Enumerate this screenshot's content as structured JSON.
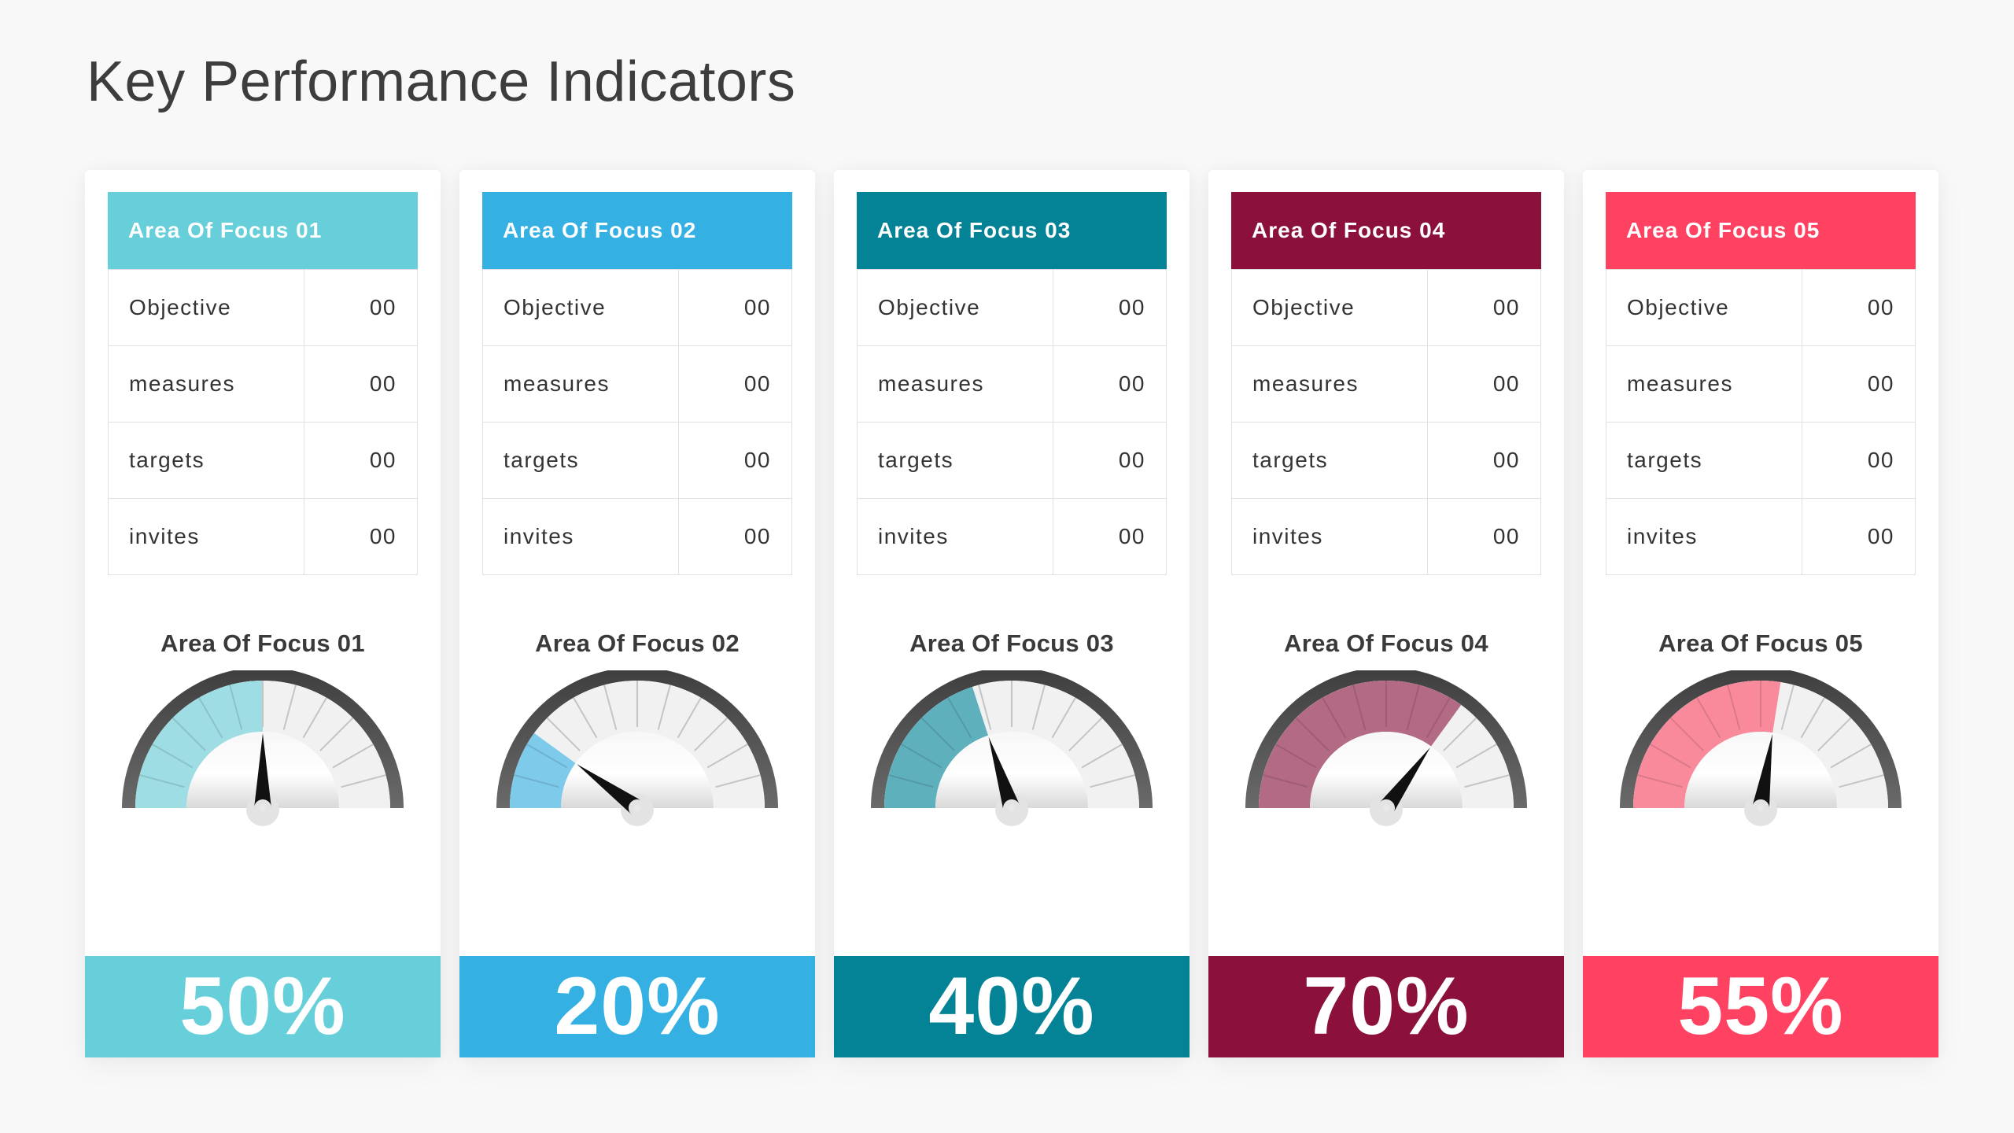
{
  "page": {
    "title": "Key Performance Indicators"
  },
  "cards": [
    {
      "header": "Area Of Focus 01",
      "color": "#66CFD9",
      "gauge_fill_color": "#9EDDE4",
      "rows": [
        {
          "label": "Objective",
          "value": "00"
        },
        {
          "label": "measures",
          "value": "00"
        },
        {
          "label": "targets",
          "value": "00"
        },
        {
          "label": "invites",
          "value": "00"
        }
      ],
      "gauge_title": "Area Of Focus 01",
      "percent": 50,
      "percent_label": "50%"
    },
    {
      "header": "Area Of Focus 02",
      "color": "#35B0E3",
      "gauge_fill_color": "#7ECAEA",
      "rows": [
        {
          "label": "Objective",
          "value": "00"
        },
        {
          "label": "measures",
          "value": "00"
        },
        {
          "label": "targets",
          "value": "00"
        },
        {
          "label": "invites",
          "value": "00"
        }
      ],
      "gauge_title": "Area Of Focus 02",
      "percent": 20,
      "percent_label": "20%"
    },
    {
      "header": "Area Of Focus 03",
      "color": "#058396",
      "gauge_fill_color": "#5FB0BD",
      "rows": [
        {
          "label": "Objective",
          "value": "00"
        },
        {
          "label": "measures",
          "value": "00"
        },
        {
          "label": "targets",
          "value": "00"
        },
        {
          "label": "invites",
          "value": "00"
        }
      ],
      "gauge_title": "Area Of Focus 03",
      "percent": 40,
      "percent_label": "40%"
    },
    {
      "header": "Area Of Focus 04",
      "color": "#8B113C",
      "gauge_fill_color": "#B36A85",
      "rows": [
        {
          "label": "Objective",
          "value": "00"
        },
        {
          "label": "measures",
          "value": "00"
        },
        {
          "label": "targets",
          "value": "00"
        },
        {
          "label": "invites",
          "value": "00"
        }
      ],
      "gauge_title": "Area Of Focus 04",
      "percent": 70,
      "percent_label": "70%"
    },
    {
      "header": "Area Of Focus 05",
      "color": "#FF4261",
      "gauge_fill_color": "#F98A9C",
      "rows": [
        {
          "label": "Objective",
          "value": "00"
        },
        {
          "label": "measures",
          "value": "00"
        },
        {
          "label": "targets",
          "value": "00"
        },
        {
          "label": "invites",
          "value": "00"
        }
      ],
      "gauge_title": "Area Of Focus 05",
      "percent": 55,
      "percent_label": "55%"
    }
  ],
  "gauge_style": {
    "ring_color": "#4a4a4a",
    "empty_color": "#f1f1f1",
    "tick_color": "#c4c4c4",
    "needle_color": "#111111",
    "segments": 12
  }
}
